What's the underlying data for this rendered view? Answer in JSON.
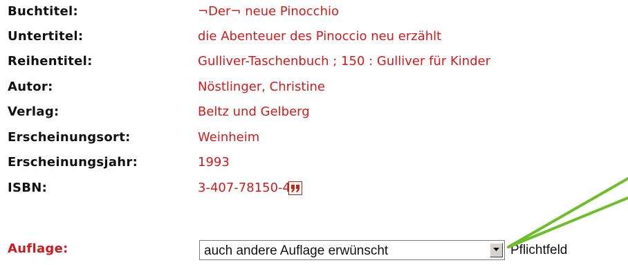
{
  "fields": {
    "buchtitel": {
      "label": "Buchtitel:",
      "value": "¬Der¬ neue Pinocchio"
    },
    "untertitel": {
      "label": "Untertitel:",
      "value": "die Abenteuer des Pinoccio neu erzählt"
    },
    "reihentitel": {
      "label": "Reihentitel:",
      "value": "Gulliver-Taschenbuch ; 150 : Gulliver für Kinder"
    },
    "autor": {
      "label": "Autor:",
      "value": "Nöstlinger, Christine"
    },
    "verlag": {
      "label": "Verlag:",
      "value": "Beltz und Gelberg"
    },
    "erscheinungsort": {
      "label": "Erscheinungsort:",
      "value": "Weinheim"
    },
    "erscheinungsjahr": {
      "label": "Erscheinungsjahr:",
      "value": "1993"
    },
    "isbn": {
      "label": "ISBN:",
      "value": "3-407-78150-4",
      "icon": "quote-icon"
    },
    "auflage": {
      "label": "Auflage:",
      "selected": "auch andere Auflage erwünscht",
      "required_hint": "Pflichtfeld"
    }
  },
  "colors": {
    "value_text": "#d21a1a",
    "label_text": "#111111",
    "required_label": "#cc1b1b",
    "callout_line": "#6cbf2a"
  },
  "icons": {
    "isbn": "quote-icon",
    "select": "chevron-down-icon"
  }
}
